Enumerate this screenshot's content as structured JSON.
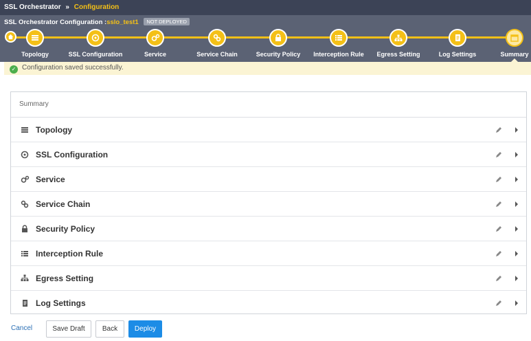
{
  "breadcrumb": {
    "root": "SSL Orchestrator",
    "separator": "»",
    "current": "Configuration"
  },
  "config": {
    "title_prefix": "SSL Orchestrator Configuration :",
    "name": "sslo_test1",
    "status_badge": "NOT DEPLOYED"
  },
  "steps": [
    {
      "label": "Topology",
      "icon": "topology-icon"
    },
    {
      "label": "SSL Configuration",
      "icon": "ssl-config-icon"
    },
    {
      "label": "Service",
      "icon": "service-icon"
    },
    {
      "label": "Service Chain",
      "icon": "service-chain-icon"
    },
    {
      "label": "Security Policy",
      "icon": "lock-icon"
    },
    {
      "label": "Interception Rule",
      "icon": "list-icon"
    },
    {
      "label": "Egress Setting",
      "icon": "egress-icon"
    },
    {
      "label": "Log Settings",
      "icon": "log-icon"
    },
    {
      "label": "Summary",
      "icon": "summary-icon"
    }
  ],
  "message": {
    "text": "Configuration saved successfully."
  },
  "summary": {
    "heading": "Summary",
    "rows": [
      {
        "label": "Topology",
        "icon": "topology-icon"
      },
      {
        "label": "SSL Configuration",
        "icon": "ssl-config-icon"
      },
      {
        "label": "Service",
        "icon": "service-icon"
      },
      {
        "label": "Service Chain",
        "icon": "service-chain-icon"
      },
      {
        "label": "Security Policy",
        "icon": "lock-icon"
      },
      {
        "label": "Interception Rule",
        "icon": "list-icon"
      },
      {
        "label": "Egress Setting",
        "icon": "egress-icon"
      },
      {
        "label": "Log Settings",
        "icon": "log-icon"
      }
    ]
  },
  "footer": {
    "cancel": "Cancel",
    "save_draft": "Save Draft",
    "back": "Back",
    "deploy": "Deploy"
  },
  "colors": {
    "accent": "#f4c017",
    "header": "#3c4356",
    "stepbar": "#5b6274",
    "primary": "#1c8ce6",
    "success": "#4cae4c"
  }
}
